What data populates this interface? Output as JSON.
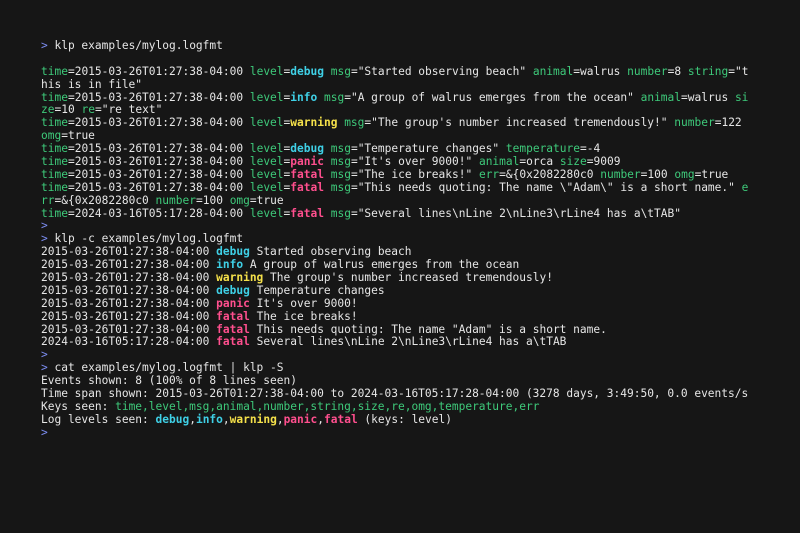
{
  "colors": {
    "background": "#161616",
    "prompt": "#7b8cf0",
    "key": "#3ec97a",
    "debug_info": "#3fd0e6",
    "warning": "#f5e14a",
    "panic_fatal": "#ff4f8e"
  },
  "prompt_symbol": ">",
  "commands": {
    "c1": " klp examples/mylog.logfmt",
    "c2": " klp -c examples/mylog.logfmt",
    "c3": " cat examples/mylog.logfmt | klp -S"
  },
  "raw": {
    "r1a": {
      "time": "2015-03-26T01:27:38-04:00",
      "level": "debug",
      "msg": "\"Started observing beach\"",
      "animal": "walrus",
      "number": "8",
      "string_wrap": "\"t"
    },
    "r1b": {
      "cont": "his is in file\""
    },
    "r2a": {
      "time": "2015-03-26T01:27:38-04:00",
      "level": "info",
      "msg": "\"A group of walrus emerges from the ocean\"",
      "animal": "walrus",
      "key_wrap": "si"
    },
    "r2b": {
      "key_rest": "ze",
      "size": "10",
      "re": "\"re text\""
    },
    "r3a": {
      "time": "2015-03-26T01:27:38-04:00",
      "level": "warning",
      "msg": "\"The group's number increased tremendously!\"",
      "number": "122"
    },
    "r3b": {
      "key_rest": "omg",
      "omg": "true"
    },
    "r4": {
      "time": "2015-03-26T01:27:38-04:00",
      "level": "debug",
      "msg": "\"Temperature changes\"",
      "temperature": "-4"
    },
    "r5": {
      "time": "2015-03-26T01:27:38-04:00",
      "level": "panic",
      "msg": "\"It's over 9000!\"",
      "animal": "orca",
      "size": "9009"
    },
    "r6": {
      "time": "2015-03-26T01:27:38-04:00",
      "level": "fatal",
      "msg": "\"The ice breaks!\"",
      "err": "&{0x2082280c0",
      "number": "100",
      "omg": "true"
    },
    "r7a": {
      "time": "2015-03-26T01:27:38-04:00",
      "level": "fatal",
      "msg": "\"This needs quoting: The name \\\"Adam\\\" is a short name.\"",
      "key_wrap": "e"
    },
    "r7b": {
      "key_rest": "rr",
      "err": "&{0x2082280c0",
      "number": "100",
      "omg": "true"
    },
    "r8": {
      "time": "2024-03-16T05:17:28-04:00",
      "level": "fatal",
      "msg": "\"Several lines\\nLine 2\\nLine3\\rLine4 has a\\tTAB\""
    }
  },
  "compact": [
    {
      "time": "2015-03-26T01:27:38-04:00",
      "level": "debug",
      "msg": "Started observing beach"
    },
    {
      "time": "2015-03-26T01:27:38-04:00",
      "level": "info",
      "msg": "A group of walrus emerges from the ocean"
    },
    {
      "time": "2015-03-26T01:27:38-04:00",
      "level": "warning",
      "msg": "The group's number increased tremendously!"
    },
    {
      "time": "2015-03-26T01:27:38-04:00",
      "level": "debug",
      "msg": "Temperature changes"
    },
    {
      "time": "2015-03-26T01:27:38-04:00",
      "level": "panic",
      "msg": "It's over 9000!"
    },
    {
      "time": "2015-03-26T01:27:38-04:00",
      "level": "fatal",
      "msg": "The ice breaks!"
    },
    {
      "time": "2015-03-26T01:27:38-04:00",
      "level": "fatal",
      "msg": "This needs quoting: The name \"Adam\" is a short name."
    },
    {
      "time": "2024-03-16T05:17:28-04:00",
      "level": "fatal",
      "msg": "Several lines\\nLine 2\\nLine3\\rLine4 has a\\tTAB"
    }
  ],
  "stats": {
    "events": "Events shown: 8 (100% of 8 lines seen)",
    "timespan": "Time span shown: 2015-03-26T01:27:38-04:00 to 2024-03-16T05:17:28-04:00 (3278 days, 3:49:50, 0.0 events/s",
    "keys_label": "Keys seen: ",
    "keys": "time,level,msg,animal,number,string,size,re,omg,temperature,err",
    "levels_label": "Log levels seen: ",
    "lv_debug": "debug",
    "lv_info": "info",
    "lv_warning": "warning",
    "lv_panic": "panic",
    "lv_fatal": "fatal",
    "comma": ",",
    "levels_suffix": " (keys: level)"
  }
}
